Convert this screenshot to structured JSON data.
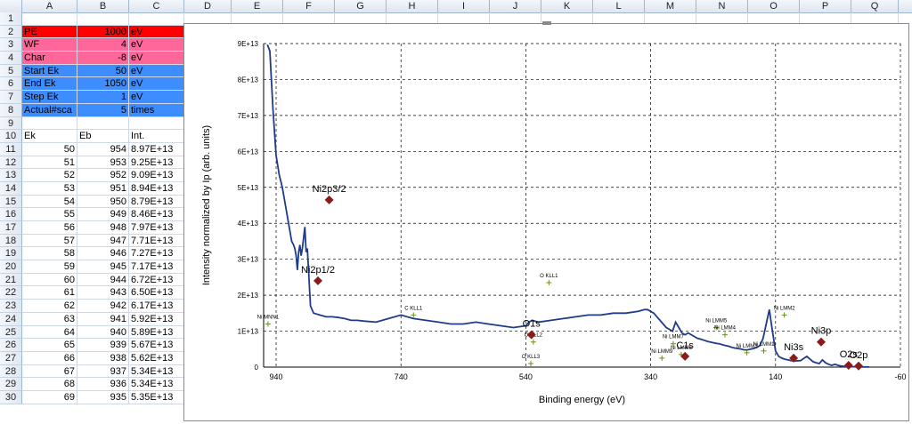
{
  "columns": [
    "A",
    "B",
    "C",
    "D",
    "E",
    "F",
    "G",
    "H",
    "I",
    "J",
    "K",
    "L",
    "M",
    "N",
    "O",
    "P",
    "Q"
  ],
  "rows": [
    {
      "n": "1",
      "a": "",
      "b": "",
      "c": ""
    },
    {
      "n": "2",
      "a": "PE",
      "b": "1000",
      "c": "eV",
      "style": "red"
    },
    {
      "n": "3",
      "a": "WF",
      "b": "4",
      "c": "eV",
      "style": "pink"
    },
    {
      "n": "4",
      "a": "Char",
      "b": "-8",
      "c": "eV",
      "style": "pink"
    },
    {
      "n": "5",
      "a": "Start Ek",
      "b": "50",
      "c": "eV",
      "style": "blue"
    },
    {
      "n": "6",
      "a": "End Ek",
      "b": "1050",
      "c": "eV",
      "style": "blue"
    },
    {
      "n": "7",
      "a": "Step Ek",
      "b": "1",
      "c": "eV",
      "style": "blue"
    },
    {
      "n": "8",
      "a": "Actual#sca",
      "b": "5",
      "c": "times",
      "style": "blue"
    },
    {
      "n": "9",
      "a": "",
      "b": "",
      "c": ""
    },
    {
      "n": "10",
      "a": "Ek",
      "b": "Eb",
      "c": "Int.",
      "header": true
    },
    {
      "n": "11",
      "a": "50",
      "b": "954",
      "c": "8.97E+13"
    },
    {
      "n": "12",
      "a": "51",
      "b": "953",
      "c": "9.25E+13"
    },
    {
      "n": "13",
      "a": "52",
      "b": "952",
      "c": "9.09E+13"
    },
    {
      "n": "14",
      "a": "53",
      "b": "951",
      "c": "8.94E+13"
    },
    {
      "n": "15",
      "a": "54",
      "b": "950",
      "c": "8.79E+13"
    },
    {
      "n": "16",
      "a": "55",
      "b": "949",
      "c": "8.46E+13"
    },
    {
      "n": "17",
      "a": "56",
      "b": "948",
      "c": "7.97E+13"
    },
    {
      "n": "18",
      "a": "57",
      "b": "947",
      "c": "7.71E+13"
    },
    {
      "n": "19",
      "a": "58",
      "b": "946",
      "c": "7.27E+13"
    },
    {
      "n": "20",
      "a": "59",
      "b": "945",
      "c": "7.17E+13"
    },
    {
      "n": "21",
      "a": "60",
      "b": "944",
      "c": "6.72E+13"
    },
    {
      "n": "22",
      "a": "61",
      "b": "943",
      "c": "6.50E+13"
    },
    {
      "n": "23",
      "a": "62",
      "b": "942",
      "c": "6.17E+13"
    },
    {
      "n": "24",
      "a": "63",
      "b": "941",
      "c": "5.92E+13"
    },
    {
      "n": "25",
      "a": "64",
      "b": "940",
      "c": "5.89E+13"
    },
    {
      "n": "26",
      "a": "65",
      "b": "939",
      "c": "5.67E+13"
    },
    {
      "n": "27",
      "a": "66",
      "b": "938",
      "c": "5.62E+13"
    },
    {
      "n": "28",
      "a": "67",
      "b": "937",
      "c": "5.34E+13"
    },
    {
      "n": "29",
      "a": "68",
      "b": "936",
      "c": "5.34E+13"
    },
    {
      "n": "30",
      "a": "69",
      "b": "935",
      "c": "5.35E+13"
    }
  ],
  "colors": {
    "pe": "#ff0000",
    "params": "#ff6699",
    "scan": "#3d8dff",
    "spectrum": "#1f3c88",
    "peak_marker": "#8b1a1a",
    "auger_marker": "#6b8e23"
  },
  "chart_data": {
    "type": "line",
    "xlabel": "Binding energy (eV)",
    "ylabel": "Intensity normalized by Ip (arb. units)",
    "xlim": [
      960,
      -60
    ],
    "x_reversed": true,
    "ylim": [
      0,
      90000000000000.0
    ],
    "x_ticks": [
      "940",
      "740",
      "540",
      "340",
      "140",
      "-60"
    ],
    "x_tick_values": [
      940,
      740,
      540,
      340,
      140,
      -60
    ],
    "y_ticks": [
      "0",
      "1E+13",
      "2E+13",
      "3E+13",
      "4E+13",
      "5E+13",
      "6E+13",
      "7E+13",
      "8E+13",
      "9E+13"
    ],
    "y_tick_values": [
      0,
      10000000000000.0,
      20000000000000.0,
      30000000000000.0,
      40000000000000.0,
      50000000000000.0,
      60000000000000.0,
      70000000000000.0,
      80000000000000.0,
      90000000000000.0
    ],
    "grid": true,
    "series": [
      {
        "x": [
          954,
          950,
          945,
          940,
          935,
          930,
          925,
          920,
          915,
          912,
          910,
          908,
          906,
          904,
          902,
          900,
          898,
          896,
          894,
          892,
          890,
          885,
          880,
          870,
          860,
          850,
          840,
          830,
          820,
          810,
          800,
          780,
          760,
          740,
          720,
          700,
          680,
          660,
          640,
          620,
          600,
          580,
          560,
          540,
          535,
          530,
          520,
          500,
          480,
          460,
          440,
          420,
          400,
          380,
          360,
          350,
          345,
          340,
          335,
          330,
          325,
          320,
          315,
          310,
          305,
          300,
          295,
          290,
          285,
          280,
          275,
          270,
          265,
          260,
          255,
          250,
          245,
          240,
          235,
          230,
          225,
          220,
          215,
          210,
          205,
          200,
          195,
          190,
          185,
          180,
          175,
          170,
          165,
          160,
          155,
          150,
          145,
          140,
          135,
          130,
          125,
          120,
          115,
          110,
          100,
          90,
          80,
          75,
          70,
          65,
          60,
          55,
          50,
          45,
          40,
          35,
          30,
          20,
          10,
          0,
          -10
        ],
        "y": [
          89700000000000.0,
          87900000000000.0,
          71700000000000.0,
          58900000000000.0,
          53500000000000.0,
          50000000000000.0,
          45000000000000.0,
          40000000000000.0,
          35000000000000.0,
          34000000000000.0,
          33000000000000.0,
          31000000000000.0,
          27000000000000.0,
          32000000000000.0,
          34000000000000.0,
          31000000000000.0,
          33000000000000.0,
          36000000000000.0,
          39000000000000.0,
          32000000000000.0,
          33000000000000.0,
          17000000000000.0,
          15000000000000.0,
          14500000000000.0,
          14000000000000.0,
          14000000000000.0,
          13800000000000.0,
          13500000000000.0,
          13000000000000.0,
          13000000000000.0,
          12800000000000.0,
          12500000000000.0,
          13500000000000.0,
          14500000000000.0,
          13500000000000.0,
          13000000000000.0,
          12500000000000.0,
          12000000000000.0,
          12000000000000.0,
          12500000000000.0,
          12000000000000.0,
          11500000000000.0,
          11000000000000.0,
          11500000000000.0,
          12500000000000.0,
          13000000000000.0,
          12500000000000.0,
          13000000000000.0,
          13500000000000.0,
          14000000000000.0,
          14500000000000.0,
          14500000000000.0,
          15000000000000.0,
          15000000000000.0,
          15500000000000.0,
          16000000000000.0,
          16000000000000.0,
          15500000000000.0,
          15000000000000.0,
          14000000000000.0,
          13000000000000.0,
          12000000000000.0,
          11000000000000.0,
          10500000000000.0,
          10000000000000.0,
          12500000000000.0,
          11000000000000.0,
          9500000000000.0,
          9000000000000.0,
          9500000000000.0,
          9000000000000.0,
          8500000000000.0,
          8000000000000.0,
          7800000000000.0,
          7500000000000.0,
          7200000000000.0,
          7000000000000.0,
          6800000000000.0,
          6600000000000.0,
          6500000000000.0,
          6200000000000.0,
          6000000000000.0,
          5800000000000.0,
          5500000000000.0,
          5300000000000.0,
          5200000000000.0,
          5000000000000.0,
          4800000000000.0,
          4800000000000.0,
          5000000000000.0,
          5200000000000.0,
          5500000000000.0,
          6000000000000.0,
          8000000000000.0,
          12000000000000.0,
          16000000000000.0,
          10000000000000.0,
          4500000000000.0,
          3000000000000.0,
          2500000000000.0,
          2200000000000.0,
          2000000000000.0,
          1800000000000.0,
          1700000000000.0,
          1800000000000.0,
          3000000000000.0,
          1500000000000.0,
          1200000000000.0,
          1000000000000.0,
          2000000000000.0,
          1200000000000.0,
          800000000000.0,
          500000000000.0,
          800000000000.0,
          500000000000.0,
          300000000000.0,
          200000000000.0,
          100000000000.0,
          100000000000.0,
          50000000000.0,
          30000000000.0
        ]
      }
    ],
    "peak_markers": [
      {
        "label": "Ni2p3/2",
        "x": 855,
        "y": 46500000000000.0
      },
      {
        "label": "Ni2p1/2",
        "x": 873,
        "y": 24000000000000.0
      },
      {
        "label": "O1s",
        "x": 531,
        "y": 9000000000000.0
      },
      {
        "label": "C1s",
        "x": 285,
        "y": 3000000000000.0
      },
      {
        "label": "Ni3s",
        "x": 111,
        "y": 2500000000000.0
      },
      {
        "label": "Ni3p",
        "x": 67,
        "y": 7000000000000.0
      },
      {
        "label": "O2s",
        "x": 23,
        "y": 500000000000.0
      },
      {
        "label": "O2p",
        "x": 7,
        "y": 300000000000.0
      }
    ],
    "auger_markers": [
      {
        "label": "Ni MNN1",
        "x": 953,
        "y": 12000000000000.0
      },
      {
        "label": "C KLL1",
        "x": 720,
        "y": 14500000000000.0
      },
      {
        "label": "O KLL1",
        "x": 503,
        "y": 23500000000000.0
      },
      {
        "label": "O KLL2",
        "x": 528,
        "y": 7000000000000.0
      },
      {
        "label": "O KLL3",
        "x": 532,
        "y": 1000000000000.0
      },
      {
        "label": "Ni LMM9",
        "x": 322,
        "y": 2500000000000.0
      },
      {
        "label": "Ni LMM7",
        "x": 304,
        "y": 6500000000000.0
      },
      {
        "label": "Ni LMM6",
        "x": 291,
        "y": 3500000000000.0
      },
      {
        "label": "Ni LMM5",
        "x": 235,
        "y": 11000000000000.0
      },
      {
        "label": "Ni LMM4",
        "x": 221,
        "y": 9000000000000.0
      },
      {
        "label": "Ni LMM3",
        "x": 186,
        "y": 4000000000000.0
      },
      {
        "label": "Ni LMM2",
        "x": 126,
        "y": 14500000000000.0
      },
      {
        "label": "Ni LMM1",
        "x": 159,
        "y": 4500000000000.0
      }
    ]
  }
}
